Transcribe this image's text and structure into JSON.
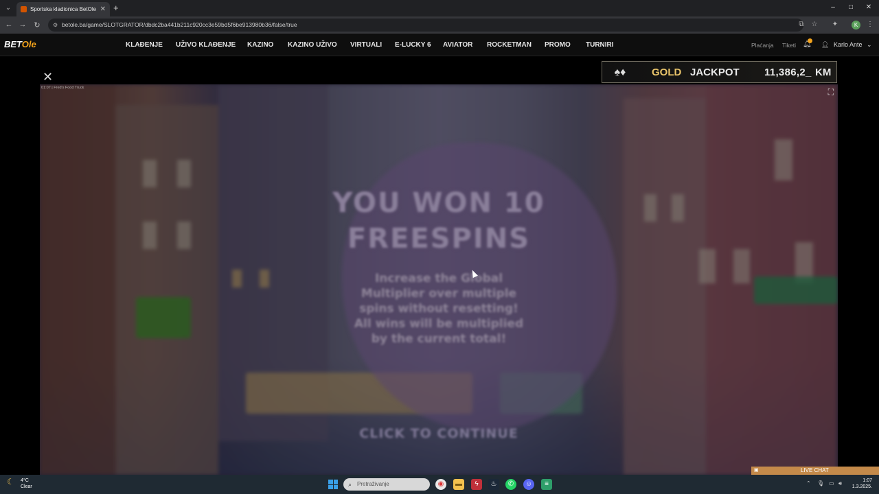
{
  "browser": {
    "tab_title": "Sportska kladionica BetOle",
    "tab_close": "✕",
    "new_tab": "+",
    "url": "betole.ba/game/SLOTGRATOR/dbdc2ba441b211c920cc3e59bd5f6be913980b36/false/true",
    "window_controls": [
      "–",
      "□",
      "✕"
    ]
  },
  "site": {
    "logo_main": "BET",
    "logo_accent": "Ole",
    "nav": [
      "KLAĐENJE",
      "UŽIVO KLAĐENJE",
      "KAZINO",
      "KAZINO UŽIVO",
      "VIRTUALI",
      "E-LUCKY 6",
      "AVIATOR",
      "ROCKETMAN",
      "PROMO",
      "TURNIRI"
    ],
    "payments": "Plaćanja",
    "tickets": "Tiketi",
    "user_name": "Karlo Ante"
  },
  "jackpot": {
    "tier": "GOLD",
    "label": "JACKPOT",
    "amount": "11,386,2_",
    "currency": "KM"
  },
  "game": {
    "info": "01:07 | Fred's Food Truck",
    "title_line1": "YOU WON 10",
    "title_line2": "FREESPINS",
    "body": [
      "Increase the Global",
      "Multiplier over multiple",
      "spins without resetting!",
      "All wins will be multiplied",
      "by the current total!"
    ],
    "cta": "CLICK TO CONTINUE"
  },
  "live_chat": "LIVE CHAT",
  "taskbar": {
    "temp": "4°C",
    "weather": "Clear",
    "search_placeholder": "Pretraživanje",
    "time": "1:07",
    "date": "1.3.2025."
  }
}
